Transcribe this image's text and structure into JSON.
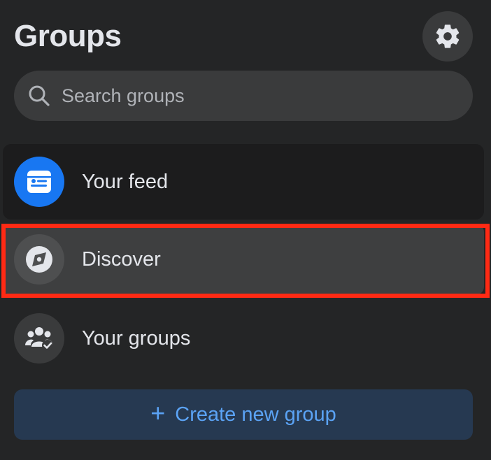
{
  "header": {
    "title": "Groups",
    "settings_icon": "gear-icon"
  },
  "search": {
    "placeholder": "Search groups",
    "icon": "search-icon"
  },
  "nav": {
    "items": [
      {
        "label": "Your feed",
        "icon": "news-feed-icon",
        "selected": false
      },
      {
        "label": "Discover",
        "icon": "compass-icon",
        "selected": true
      },
      {
        "label": "Your groups",
        "icon": "groups-icon",
        "selected": false
      }
    ]
  },
  "create_button": {
    "label": "Create new group",
    "icon": "plus-icon"
  },
  "colors": {
    "background": "#242526",
    "accent_blue": "#1877f2",
    "link_blue": "#5ba3f5",
    "highlight": "#ff2a14"
  }
}
